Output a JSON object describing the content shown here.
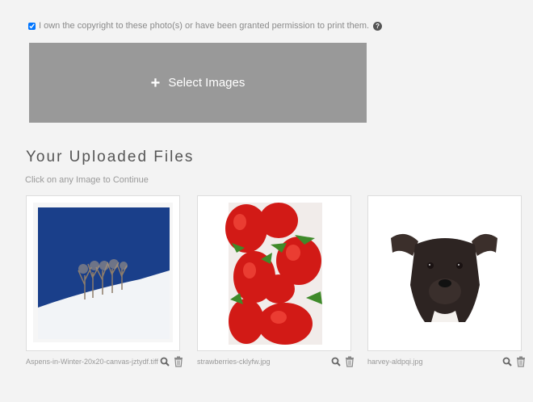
{
  "consent": {
    "label": "I own the copyright to these photo(s) or have been granted permission to print them.",
    "help_icon": "?"
  },
  "select_button": {
    "icon": "+",
    "label": "Select Images"
  },
  "uploads": {
    "title": "Your Uploaded Files",
    "hint": "Click on any Image to Continue",
    "files": [
      {
        "name": "Aspens-in-Winter-20x20-canvas-jztydf.tiff",
        "thumb": "aspens-snow-photo"
      },
      {
        "name": "strawberries-cklyfw.jpg",
        "thumb": "strawberries-photo"
      },
      {
        "name": "harvey-aldpqi.jpg",
        "thumb": "dog-photo"
      }
    ]
  },
  "colors": {
    "button_bg": "#999999",
    "card_border": "#dddddd",
    "background": "#f3f3f3"
  },
  "icons": [
    "help-icon",
    "plus-icon",
    "magnify-icon",
    "trash-icon"
  ]
}
